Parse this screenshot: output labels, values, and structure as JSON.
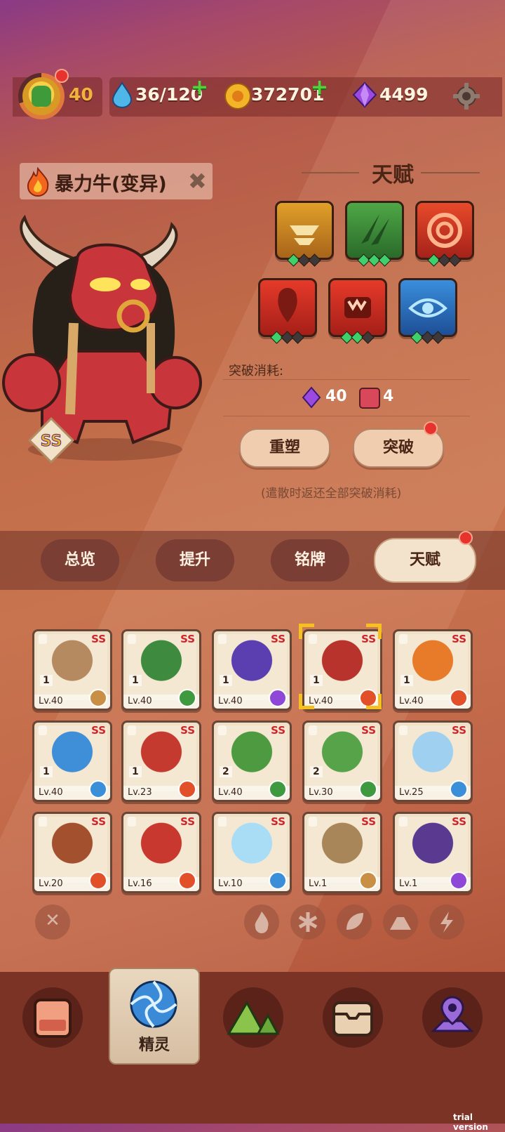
{
  "topbar": {
    "level": "40",
    "stamina": "36/120",
    "gold": "372701",
    "gems": "4499"
  },
  "monster": {
    "name": "暴力牛(变异)",
    "rarity": "SS"
  },
  "talent_panel": {
    "title": "天赋",
    "cost_label": "突破消耗:",
    "cost_gems": "40",
    "cost_items": "4",
    "reshape_label": "重塑",
    "breakthrough_label": "突破",
    "note": "(遣散时返还全部突破消耗)"
  },
  "tabs": [
    "总览",
    "提升",
    "铭牌",
    "天赋"
  ],
  "cards": [
    {
      "rarity": "SS",
      "count": "1",
      "level": "Lv.40",
      "element": "earth",
      "color": "#b58a60"
    },
    {
      "rarity": "SS",
      "count": "1",
      "level": "Lv.40",
      "element": "grass",
      "color": "#3e8a3e"
    },
    {
      "rarity": "SS",
      "count": "1",
      "level": "Lv.40",
      "element": "thunder",
      "color": "#5b3fb0"
    },
    {
      "rarity": "SS",
      "count": "1",
      "level": "Lv.40",
      "element": "fire",
      "color": "#b8332c"
    },
    {
      "rarity": "SS",
      "count": "1",
      "level": "Lv.40",
      "element": "fire",
      "color": "#e87b2a"
    },
    {
      "rarity": "SS",
      "count": "1",
      "level": "Lv.40",
      "element": "ice",
      "color": "#3f8ed8"
    },
    {
      "rarity": "SS",
      "count": "1",
      "level": "Lv.23",
      "element": "fire",
      "color": "#c53a2f"
    },
    {
      "rarity": "SS",
      "count": "2",
      "level": "Lv.40",
      "element": "grass",
      "color": "#4e9a40"
    },
    {
      "rarity": "SS",
      "count": "2",
      "level": "Lv.30",
      "element": "grass",
      "color": "#56a34a"
    },
    {
      "rarity": "SS",
      "count": "",
      "level": "Lv.25",
      "element": "ice",
      "color": "#9fd0ef"
    },
    {
      "rarity": "SS",
      "count": "",
      "level": "Lv.20",
      "element": "fire",
      "color": "#a3502f"
    },
    {
      "rarity": "SS",
      "count": "",
      "level": "Lv.16",
      "element": "fire",
      "color": "#c8382e"
    },
    {
      "rarity": "SS",
      "count": "",
      "level": "Lv.10",
      "element": "ice",
      "color": "#a8ddf5"
    },
    {
      "rarity": "SS",
      "count": "",
      "level": "Lv.1",
      "element": "earth",
      "color": "#a8865a"
    },
    {
      "rarity": "SS",
      "count": "",
      "level": "Lv.1",
      "element": "thunder",
      "color": "#5a3a90"
    }
  ],
  "bottom_nav": {
    "active_label": "精灵"
  },
  "watermark": "trial version",
  "colors": {
    "fire": "#e2502a",
    "grass": "#3f9a3f",
    "ice": "#3a8fd8",
    "earth": "#c98f45",
    "thunder": "#8f47d8"
  }
}
